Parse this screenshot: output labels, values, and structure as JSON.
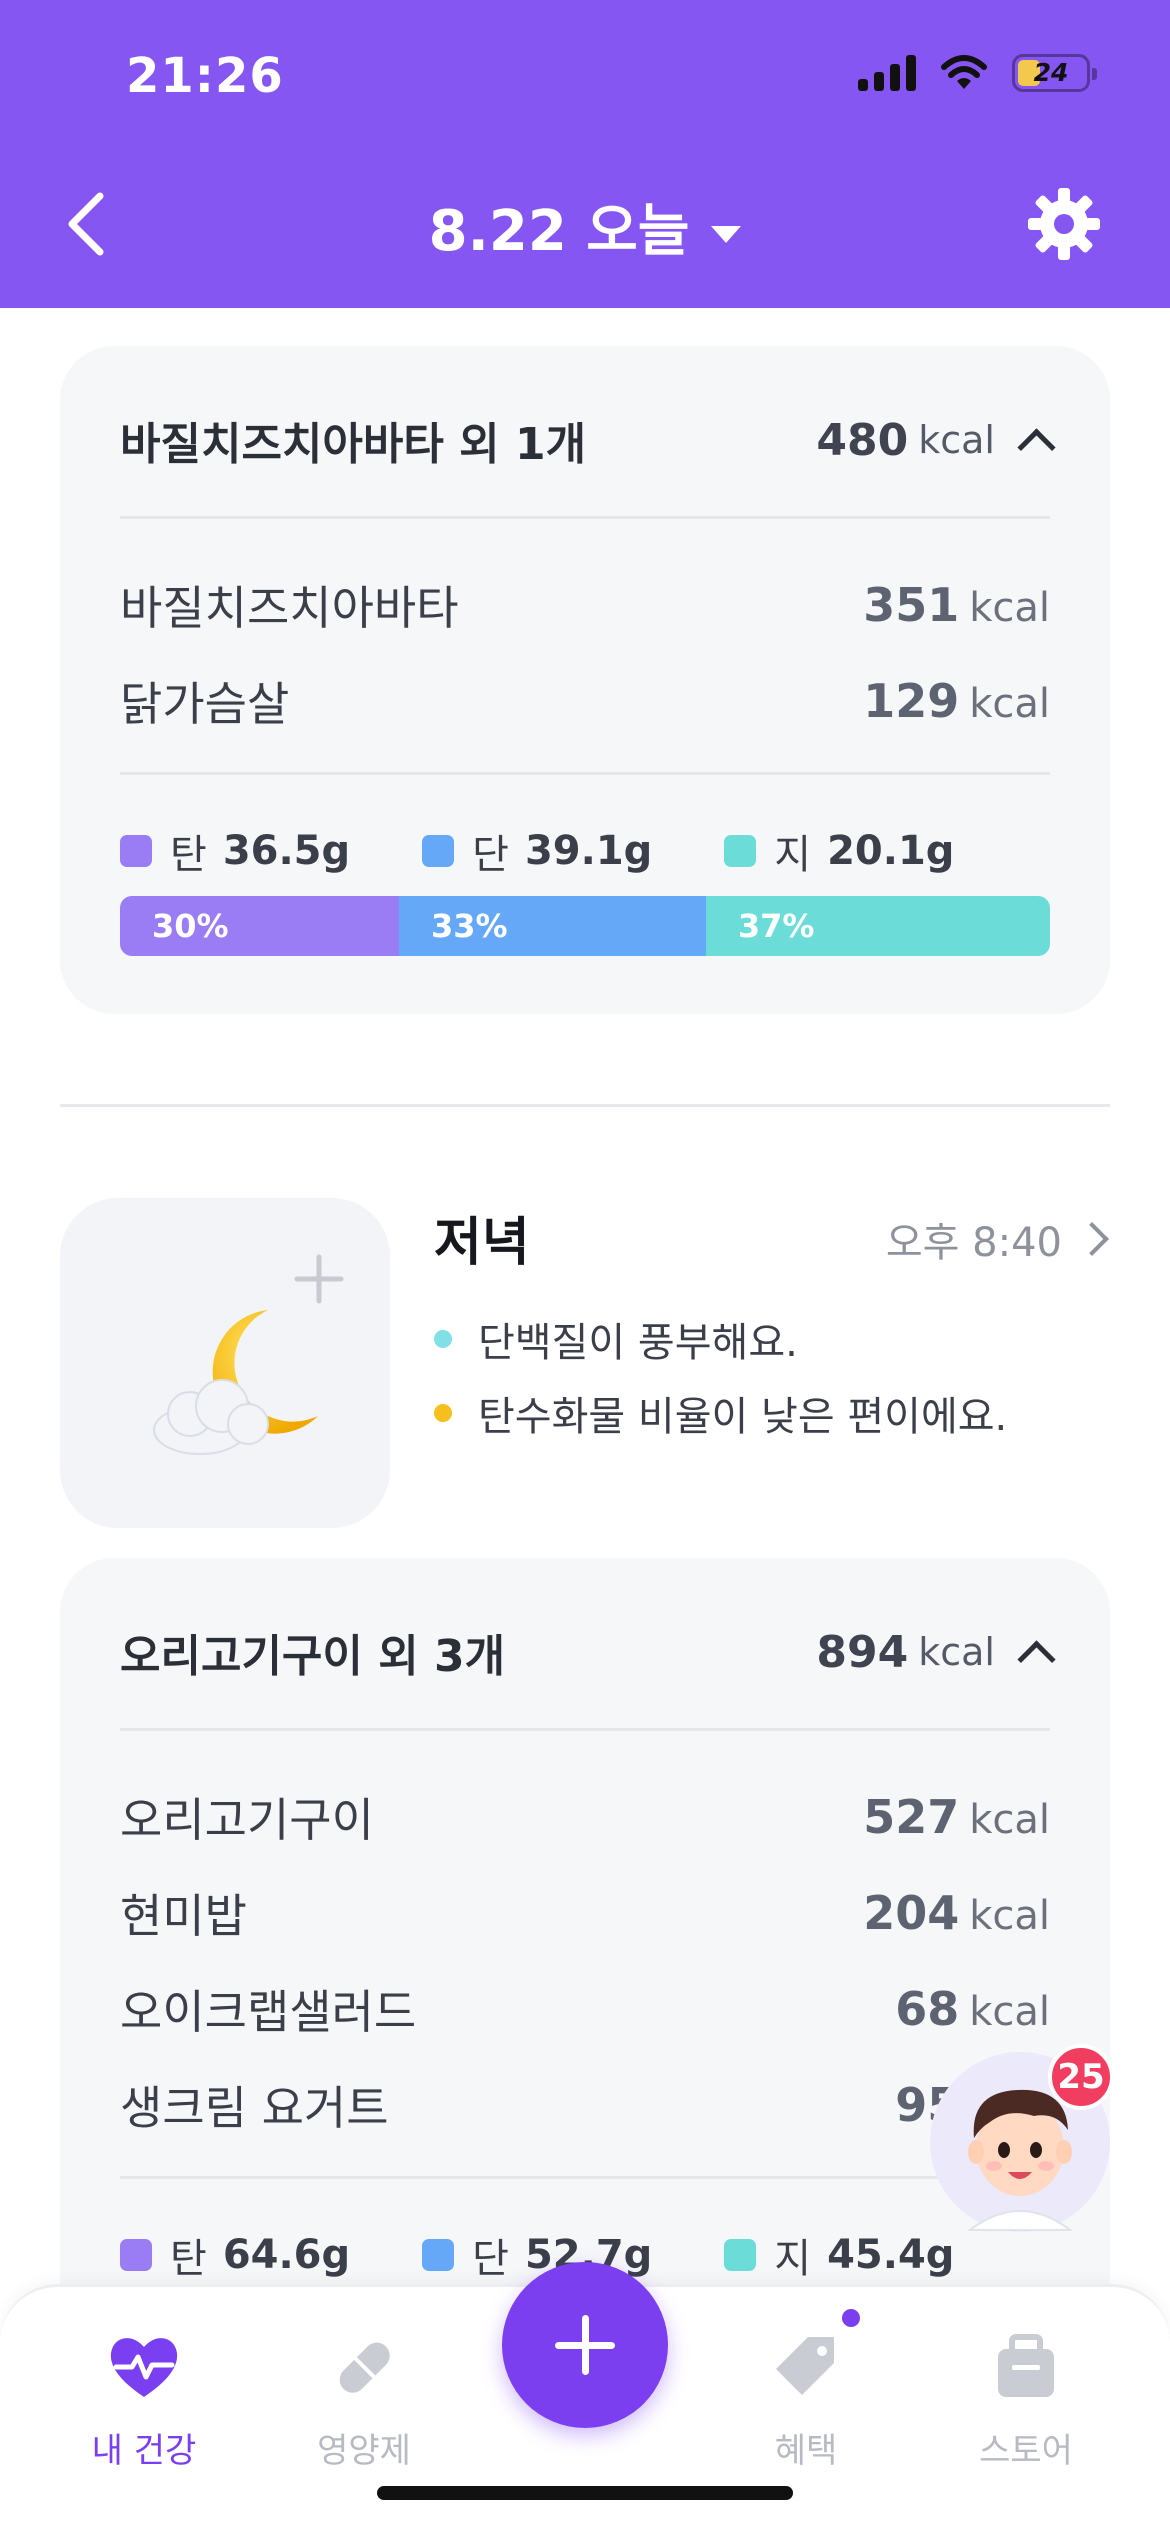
{
  "status_bar": {
    "time": "21:26",
    "battery": "24"
  },
  "nav": {
    "title": "8.22 오늘"
  },
  "lunch_card": {
    "title": "바질치즈치아바타 외 1개",
    "total_kcal": "480",
    "unit": "kcal",
    "items": [
      {
        "name": "바질치즈치아바타",
        "kcal": "351"
      },
      {
        "name": "닭가슴살",
        "kcal": "129"
      }
    ],
    "macros": [
      {
        "label": "탄",
        "value": "36.5g"
      },
      {
        "label": "단",
        "value": "39.1g"
      },
      {
        "label": "지",
        "value": "20.1g"
      }
    ],
    "ratio": [
      {
        "label": "30%",
        "percent": 30
      },
      {
        "label": "33%",
        "percent": 33
      },
      {
        "label": "37%",
        "percent": 37
      }
    ]
  },
  "dinner": {
    "title": "저녁",
    "time": "오후 8:40",
    "tips": [
      {
        "text": "단백질이 풍부해요.",
        "color": "#7fe0e6"
      },
      {
        "text": "탄수화물 비율이 낮은 편이에요.",
        "color": "#f5bf1e"
      }
    ]
  },
  "dinner_card": {
    "title": "오리고기구이 외 3개",
    "total_kcal": "894",
    "unit": "kcal",
    "items": [
      {
        "name": "오리고기구이",
        "kcal": "527"
      },
      {
        "name": "현미밥",
        "kcal": "204"
      },
      {
        "name": "오이크랩샐러드",
        "kcal": "68"
      },
      {
        "name": "생크림 요거트",
        "kcal": "95"
      }
    ],
    "macros": [
      {
        "label": "탄",
        "value": "64.6g"
      },
      {
        "label": "단",
        "value": "52.7g"
      },
      {
        "label": "지",
        "value": "45.4g"
      }
    ]
  },
  "colors": {
    "header": "#8556f2",
    "carb": "#9a7cf5",
    "protein": "#66a8f8",
    "fat": "#6cdcd9",
    "accent": "#7b3ff0"
  },
  "bot": {
    "badge": "25"
  },
  "tabbar": {
    "tabs": [
      {
        "label": "내 건강",
        "icon": "heart-pulse-icon"
      },
      {
        "label": "영양제",
        "icon": "pill-icon"
      },
      {
        "label": "혜택",
        "icon": "tag-icon"
      },
      {
        "label": "스토어",
        "icon": "bag-icon"
      }
    ]
  }
}
